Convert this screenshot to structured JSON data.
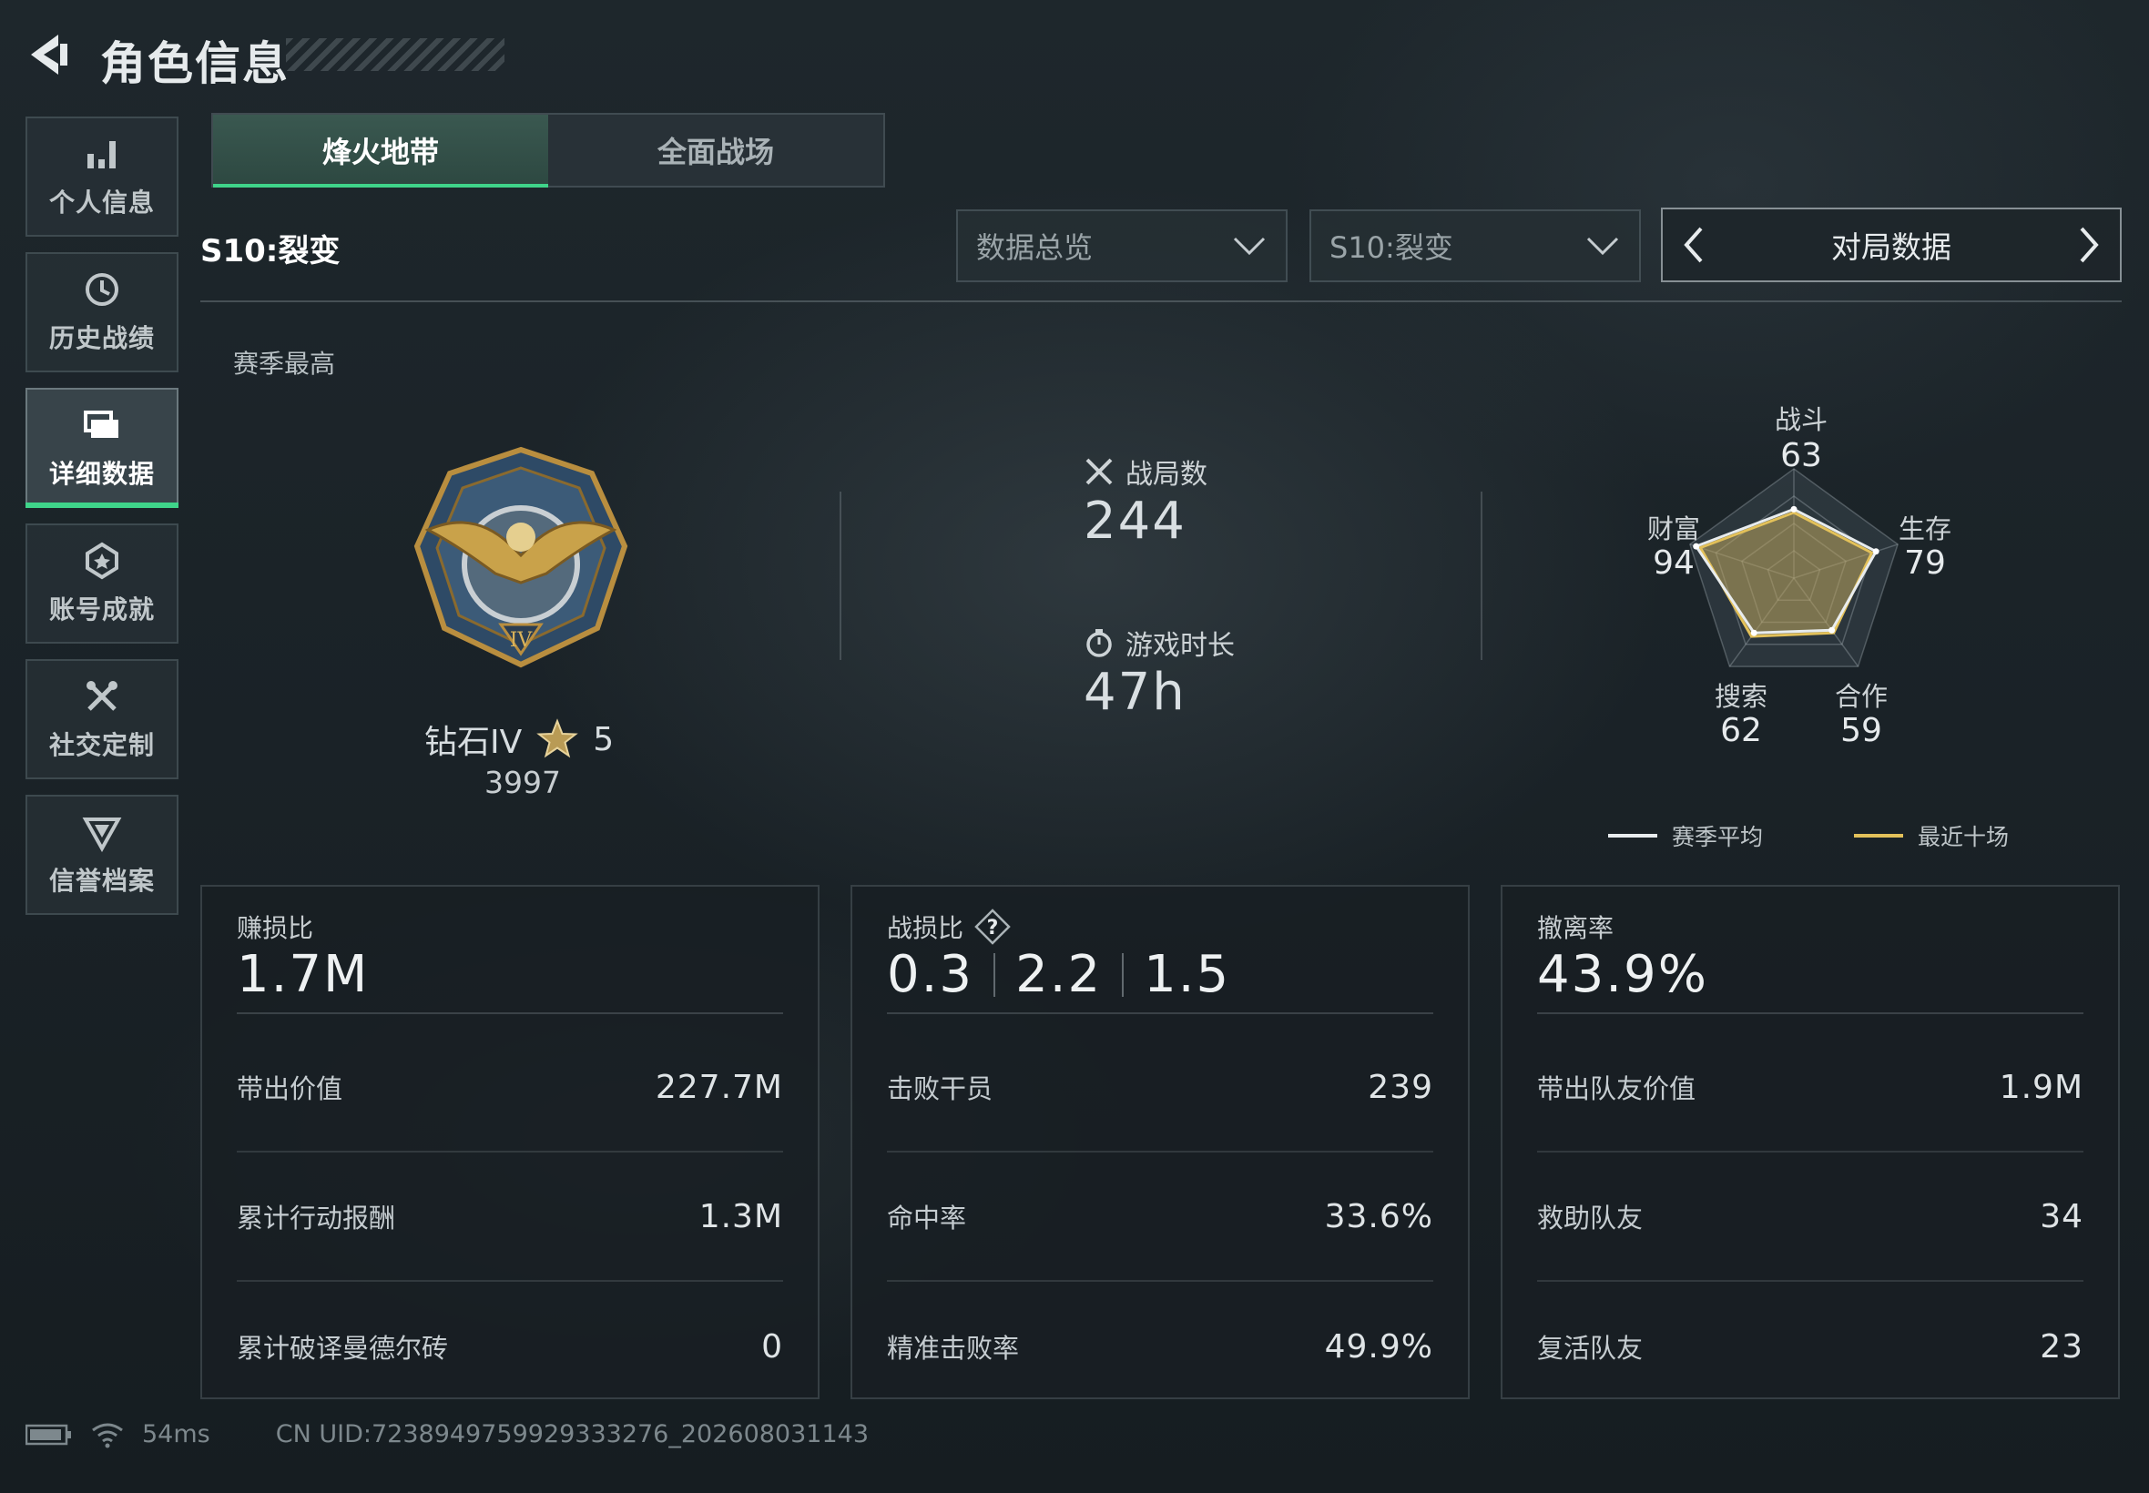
{
  "header": {
    "title": "角色信息"
  },
  "sidebar": {
    "items": [
      {
        "label": "个人信息",
        "icon": "bar-chart-icon"
      },
      {
        "label": "历史战绩",
        "icon": "history-icon"
      },
      {
        "label": "详细数据",
        "icon": "folder-icon",
        "active": true
      },
      {
        "label": "账号成就",
        "icon": "achievement-icon"
      },
      {
        "label": "社交定制",
        "icon": "tools-icon"
      },
      {
        "label": "信誉档案",
        "icon": "shield-icon"
      }
    ]
  },
  "tabs": [
    {
      "label": "烽火地带",
      "active": true
    },
    {
      "label": "全面战场",
      "active": false
    }
  ],
  "filters": {
    "season_label": "S10:裂变",
    "category_dropdown": "数据总览",
    "season_dropdown": "S10:裂变",
    "data_nav": "对局数据"
  },
  "overview": {
    "season_best_label": "赛季最高",
    "rank_name": "钻石IV",
    "rank_stars": "5",
    "rank_score": "3997",
    "matches_label": "战局数",
    "matches_value": "244",
    "playtime_label": "游戏时长",
    "playtime_value": "47h"
  },
  "radar": {
    "axes": [
      {
        "label": "战斗",
        "value": "63"
      },
      {
        "label": "生存",
        "value": "79"
      },
      {
        "label": "合作",
        "value": "59"
      },
      {
        "label": "搜索",
        "value": "62"
      },
      {
        "label": "财富",
        "value": "94"
      }
    ],
    "season_avg": [
      63,
      79,
      59,
      62,
      94
    ],
    "recent_ten": [
      60,
      75,
      62,
      66,
      90
    ],
    "legend": {
      "season_avg": "赛季平均",
      "recent_ten": "最近十场"
    },
    "colors": {
      "season_avg": "#e8ecee",
      "recent_ten": "#e3c15a"
    }
  },
  "cards": [
    {
      "caption": "赚损比",
      "main_values": [
        "1.7M"
      ],
      "rows": [
        {
          "label": "带出价值",
          "value": "227.7M"
        },
        {
          "label": "累计行动报酬",
          "value": "1.3M"
        },
        {
          "label": "累计破译曼德尔砖",
          "value": "0"
        }
      ]
    },
    {
      "caption": "战损比",
      "help_icon": "?",
      "main_values": [
        "0.3",
        "2.2",
        "1.5"
      ],
      "rows": [
        {
          "label": "击败干员",
          "value": "239"
        },
        {
          "label": "命中率",
          "value": "33.6%"
        },
        {
          "label": "精准击败率",
          "value": "49.9%"
        }
      ]
    },
    {
      "caption": "撤离率",
      "main_values": [
        "43.9%"
      ],
      "rows": [
        {
          "label": "带出队友价值",
          "value": "1.9M"
        },
        {
          "label": "救助队友",
          "value": "34"
        },
        {
          "label": "复活队友",
          "value": "23"
        }
      ]
    }
  ],
  "status": {
    "ping": "54ms",
    "uid": "CN UID:7238949759929333276_202608031143"
  },
  "colors": {
    "accent": "#3fd48a",
    "gold": "#d9b25a"
  }
}
